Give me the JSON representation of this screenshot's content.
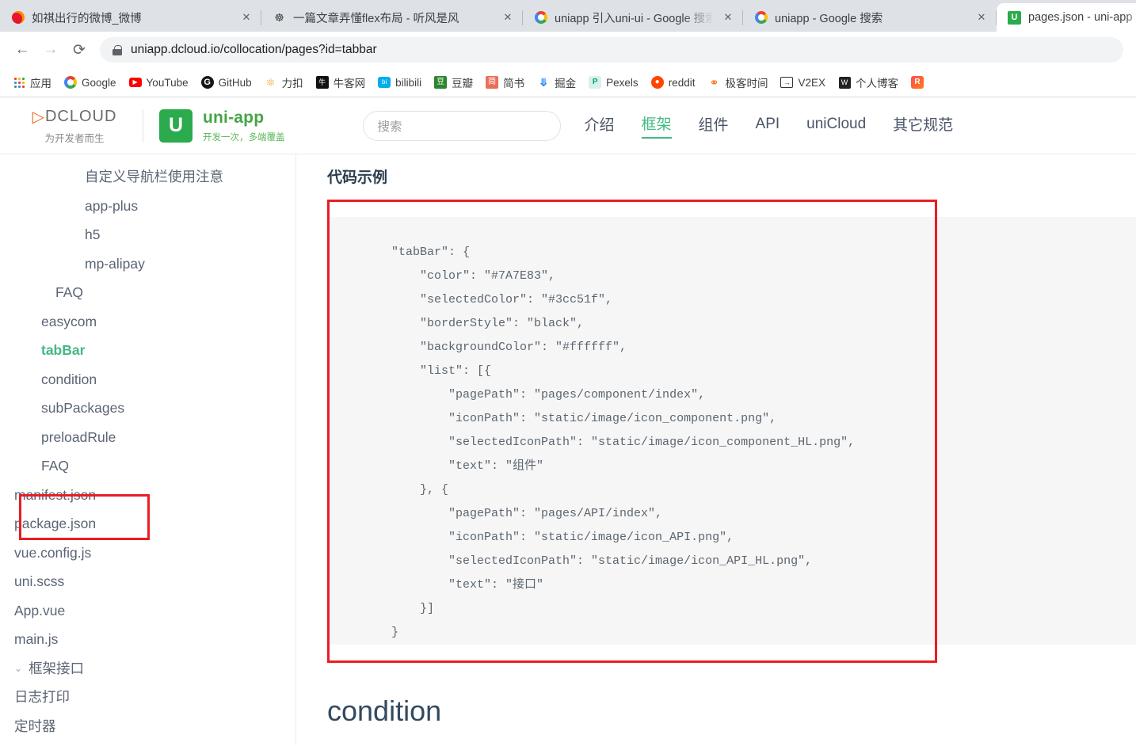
{
  "browser": {
    "tabs": [
      {
        "title": "如祺出行的微博_微博",
        "favicon": "weibo-icon",
        "active": false,
        "close_label": "✕"
      },
      {
        "title": "一篇文章弄懂flex布局 - 听风是风",
        "favicon": "person-icon",
        "active": false,
        "close_label": "✕"
      },
      {
        "title": "uniapp 引入uni-ui - Google 搜索",
        "favicon": "google-icon",
        "active": false,
        "close_label": "✕"
      },
      {
        "title": "uniapp - Google 搜索",
        "favicon": "google-icon",
        "active": false,
        "close_label": "✕"
      },
      {
        "title": "pages.json - uni-app",
        "favicon": "uniapp-icon",
        "active": true,
        "close_label": ""
      }
    ],
    "toolbar": {
      "back_label": "←",
      "forward_label": "→",
      "reload_label": "⟳",
      "url": "uniapp.dcloud.io/collocation/pages?id=tabbar",
      "security_icon": "lock-icon"
    },
    "bookmarks": [
      {
        "label": "应用",
        "icon": "apps-grid-icon"
      },
      {
        "label": "Google",
        "icon": "google-icon"
      },
      {
        "label": "YouTube",
        "icon": "youtube-icon"
      },
      {
        "label": "GitHub",
        "icon": "github-icon"
      },
      {
        "label": "力扣",
        "icon": "leetcode-icon"
      },
      {
        "label": "牛客网",
        "icon": "nowcoder-icon"
      },
      {
        "label": "bilibili",
        "icon": "bilibili-icon"
      },
      {
        "label": "豆瓣",
        "icon": "douban-icon"
      },
      {
        "label": "简书",
        "icon": "jianshu-icon"
      },
      {
        "label": "掘金",
        "icon": "juejin-icon"
      },
      {
        "label": "Pexels",
        "icon": "pexels-icon"
      },
      {
        "label": "reddit",
        "icon": "reddit-icon"
      },
      {
        "label": "极客时间",
        "icon": "geektime-icon"
      },
      {
        "label": "V2EX",
        "icon": "v2ex-icon"
      },
      {
        "label": "个人博客",
        "icon": "blog-icon"
      },
      {
        "label": "",
        "icon": "cut-icon"
      }
    ]
  },
  "site": {
    "dcloud": {
      "name": "DCLOUD",
      "tagline": "为开发者而生"
    },
    "uniapp": {
      "logo_letter": "U",
      "name": "uni-app",
      "slogan": "开发一次，多端覆盖"
    },
    "search": {
      "placeholder": "搜索",
      "value": ""
    },
    "nav": [
      {
        "label": "介绍",
        "active": false
      },
      {
        "label": "框架",
        "active": true
      },
      {
        "label": "组件",
        "active": false
      },
      {
        "label": "API",
        "active": false
      },
      {
        "label": "uniCloud",
        "active": false
      },
      {
        "label": "其它规范",
        "active": false
      }
    ]
  },
  "sidebar": {
    "items": [
      {
        "label": "自定义导航栏使用注意",
        "level": 4,
        "current": false,
        "group": false
      },
      {
        "label": "app-plus",
        "level": 4,
        "current": false,
        "group": false
      },
      {
        "label": "h5",
        "level": 4,
        "current": false,
        "group": false
      },
      {
        "label": "mp-alipay",
        "level": 4,
        "current": false,
        "group": false
      },
      {
        "label": "FAQ",
        "level": 3,
        "current": false,
        "group": false
      },
      {
        "label": "easycom",
        "level": 2,
        "current": false,
        "group": false
      },
      {
        "label": "tabBar",
        "level": 2,
        "current": true,
        "group": false
      },
      {
        "label": "condition",
        "level": 2,
        "current": false,
        "group": false
      },
      {
        "label": "subPackages",
        "level": 2,
        "current": false,
        "group": false
      },
      {
        "label": "preloadRule",
        "level": 2,
        "current": false,
        "group": false
      },
      {
        "label": "FAQ",
        "level": 2,
        "current": false,
        "group": false
      },
      {
        "label": "manifest.json",
        "level": 1,
        "current": false,
        "group": false
      },
      {
        "label": "package.json",
        "level": 1,
        "current": false,
        "group": false
      },
      {
        "label": "vue.config.js",
        "level": 1,
        "current": false,
        "group": false
      },
      {
        "label": "uni.scss",
        "level": 1,
        "current": false,
        "group": false
      },
      {
        "label": "App.vue",
        "level": 1,
        "current": false,
        "group": false
      },
      {
        "label": "main.js",
        "level": 1,
        "current": false,
        "group": false
      },
      {
        "label": "框架接口",
        "level": 0,
        "current": false,
        "group": true,
        "chevron": "⌄"
      },
      {
        "label": "日志打印",
        "level": 1,
        "current": false,
        "group": false
      },
      {
        "label": "定时器",
        "level": 1,
        "current": false,
        "group": false
      }
    ],
    "highlight_target": "tabBar"
  },
  "main": {
    "section_title": "代码示例",
    "code": "    \"tabBar\": {\n        \"color\": \"#7A7E83\",\n        \"selectedColor\": \"#3cc51f\",\n        \"borderStyle\": \"black\",\n        \"backgroundColor\": \"#ffffff\",\n        \"list\": [{\n            \"pagePath\": \"pages/component/index\",\n            \"iconPath\": \"static/image/icon_component.png\",\n            \"selectedIconPath\": \"static/image/icon_component_HL.png\",\n            \"text\": \"组件\"\n        }, {\n            \"pagePath\": \"pages/API/index\",\n            \"iconPath\": \"static/image/icon_API.png\",\n            \"selectedIconPath\": \"static/image/icon_API_HL.png\",\n            \"text\": \"接口\"\n        }]\n    }",
    "next_heading": "condition",
    "annotation_color": "#e81d25"
  }
}
